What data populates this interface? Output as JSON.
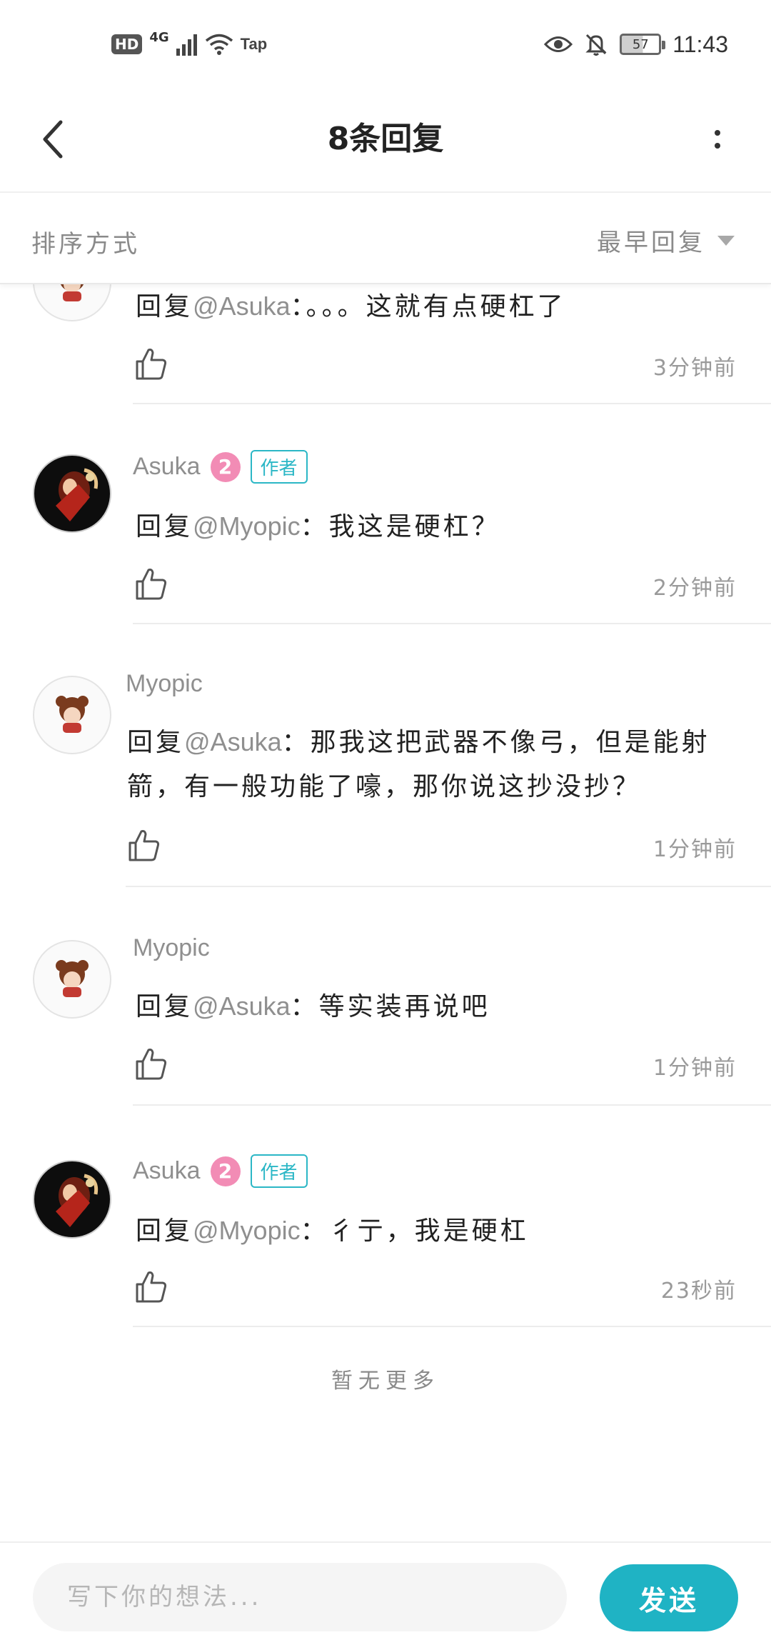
{
  "status_bar": {
    "hd": "HD",
    "network": "4G",
    "tap": "Tap",
    "battery": "57",
    "time": "11:43"
  },
  "header": {
    "title": "8条回复"
  },
  "sort": {
    "label": "排序方式",
    "value": "最早回复"
  },
  "replies": [
    {
      "user": "",
      "level": "",
      "author_badge": "",
      "prefix": "回复",
      "mention": "@Asuka",
      "text": "：。。。这就有点硬杠了",
      "time": "3分钟前",
      "avatar": "myopic"
    },
    {
      "user": "Asuka",
      "level": "2",
      "author_badge": "作者",
      "prefix": "回复",
      "mention": "@Myopic",
      "text": "：我这是硬杠？",
      "time": "2分钟前",
      "avatar": "asuka"
    },
    {
      "user": "Myopic",
      "level": "",
      "author_badge": "",
      "prefix": "回复",
      "mention": "@Asuka",
      "text": "：那我这把武器不像弓，但是能射箭，有一般功能了嚎，那你说这抄没抄？",
      "time": "1分钟前",
      "avatar": "myopic"
    },
    {
      "user": "Myopic",
      "level": "",
      "author_badge": "",
      "prefix": "回复",
      "mention": "@Asuka",
      "text": "：等实装再说吧",
      "time": "1分钟前",
      "avatar": "myopic"
    },
    {
      "user": "Asuka",
      "level": "2",
      "author_badge": "作者",
      "prefix": "回复",
      "mention": "@Myopic",
      "text": "：彳亍，我是硬杠",
      "time": "23秒前",
      "avatar": "asuka"
    }
  ],
  "no_more": "暂无更多",
  "composer": {
    "placeholder": "写下你的想法...",
    "send_label": "发送"
  },
  "colors": {
    "accent": "#1fb3c4",
    "level_badge": "#f28cb5",
    "muted_text": "#8f8f8f"
  },
  "icons": [
    "back-icon",
    "more-icon",
    "dropdown-triangle-icon",
    "thumbs-up-icon",
    "eye-icon",
    "bell-off-icon",
    "signal-icon",
    "wifi-icon"
  ]
}
